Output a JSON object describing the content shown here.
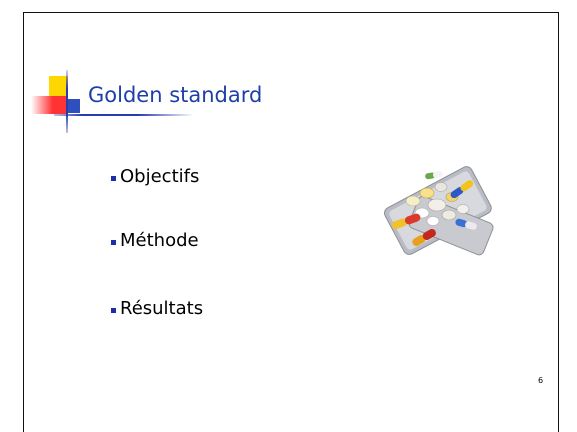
{
  "slide": {
    "title": "Golden standard",
    "bullets": [
      "Objectifs",
      "Méthode",
      "Résultats"
    ],
    "page_number": "6"
  },
  "colors": {
    "title": "#1f3fa8",
    "bullet_marker": "#1a2fa8",
    "logo_yellow": "#ffd700",
    "logo_red": "#ff3333",
    "logo_blue": "#2f4fbf"
  },
  "icons": {
    "logo": "decorative-squares-logo",
    "illustration": "pills-blister-pack-image"
  }
}
